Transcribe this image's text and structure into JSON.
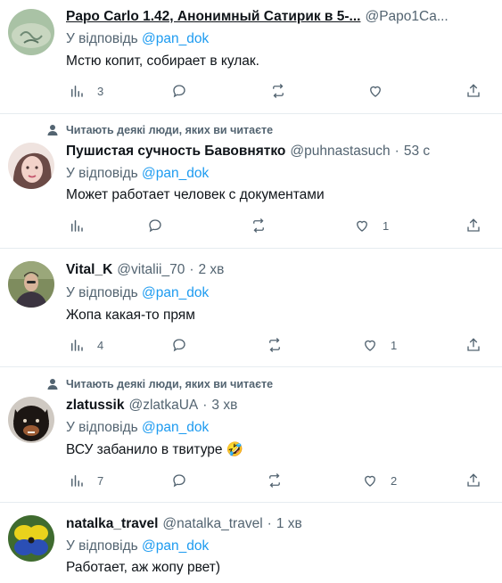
{
  "reply_prefix": "У відповідь",
  "tweets": [
    {
      "social": "",
      "name": "Papo Carlo 1.42, Анонимный Сатирик в 5-...",
      "handle": "@Papo1Ca...",
      "time": "",
      "reply_to": "@pan_dok",
      "text": "Мстю копит, собирает в кулак.",
      "stats": {
        "views": "3",
        "reply": "",
        "retweet": "",
        "like": ""
      }
    },
    {
      "social": "Читають деякі люди, яких ви читаєте",
      "name": "Пушистая сучность Бавовнятко",
      "handle": "@puhnastasuch",
      "time": "53 с",
      "reply_to": "@pan_dok",
      "text": "Может работает человек с документами",
      "stats": {
        "views": "",
        "reply": "",
        "retweet": "",
        "like": "1"
      }
    },
    {
      "social": "",
      "name": "Vital_K",
      "handle": "@vitalii_70",
      "time": "2 хв",
      "reply_to": "@pan_dok",
      "text": "Жопа какая-то прям",
      "stats": {
        "views": "4",
        "reply": "",
        "retweet": "",
        "like": "1"
      }
    },
    {
      "social": "Читають деякі люди, яких ви читаєте",
      "name": "zlatussik",
      "handle": "@zlatkaUA",
      "time": "3 хв",
      "reply_to": "@pan_dok",
      "text": "ВСУ забанило в твитуре 🤣",
      "stats": {
        "views": "7",
        "reply": "",
        "retweet": "",
        "like": "2"
      }
    },
    {
      "social": "",
      "name": "natalka_travel",
      "handle": "@natalka_travel",
      "time": "1 хв",
      "reply_to": "@pan_dok",
      "text": "Работает, аж жопу рвет)",
      "stats": {
        "views": "",
        "reply": "",
        "retweet": "",
        "like": ""
      }
    }
  ],
  "colors": {
    "accent": "#1d9bf0",
    "muted": "#536471",
    "text": "#0f1419",
    "divider": "#e6ecf0"
  }
}
